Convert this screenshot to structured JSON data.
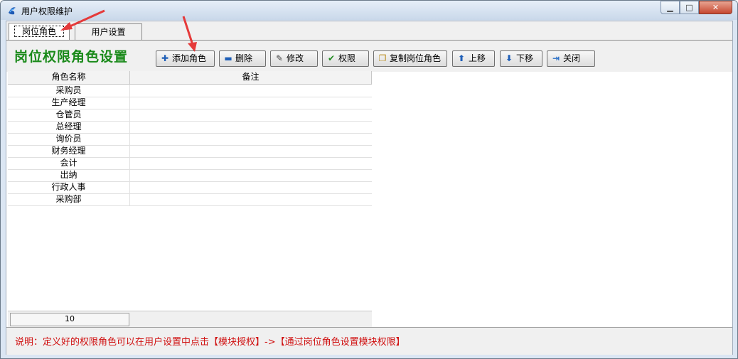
{
  "window": {
    "title": "用户权限维护"
  },
  "tabs": [
    {
      "label": "岗位角色"
    },
    {
      "label": "用户设置"
    }
  ],
  "toolbar": {
    "heading": "岗位权限角色设置",
    "buttons": [
      {
        "label": "添加角色",
        "icon": "plus-icon"
      },
      {
        "label": "删除",
        "icon": "minus-icon"
      },
      {
        "label": "修改",
        "icon": "edit-icon"
      },
      {
        "label": "权限",
        "icon": "check-icon"
      },
      {
        "label": "复制岗位角色",
        "icon": "copy-icon"
      },
      {
        "label": "上移",
        "icon": "arrow-up-icon"
      },
      {
        "label": "下移",
        "icon": "arrow-down-icon"
      },
      {
        "label": "关闭",
        "icon": "exit-icon"
      }
    ]
  },
  "grid": {
    "columns": [
      "角色名称",
      "备注"
    ],
    "rows": [
      {
        "name": "采购员",
        "note": ""
      },
      {
        "name": "生产经理",
        "note": ""
      },
      {
        "name": "仓管员",
        "note": ""
      },
      {
        "name": "总经理",
        "note": ""
      },
      {
        "name": "询价员",
        "note": ""
      },
      {
        "name": "财务经理",
        "note": ""
      },
      {
        "name": "会计",
        "note": ""
      },
      {
        "name": "出纳",
        "note": ""
      },
      {
        "name": "行政人事",
        "note": ""
      },
      {
        "name": "采购部",
        "note": ""
      }
    ],
    "count": "10"
  },
  "footer": {
    "note": "说明：定义好的权限角色可以在用户设置中点击【模块授权】->【通过岗位角色设置模块权限】"
  },
  "colors": {
    "heading": "#1a8a1a",
    "note": "#d01010",
    "annotation_arrow": "#e53a3a"
  }
}
